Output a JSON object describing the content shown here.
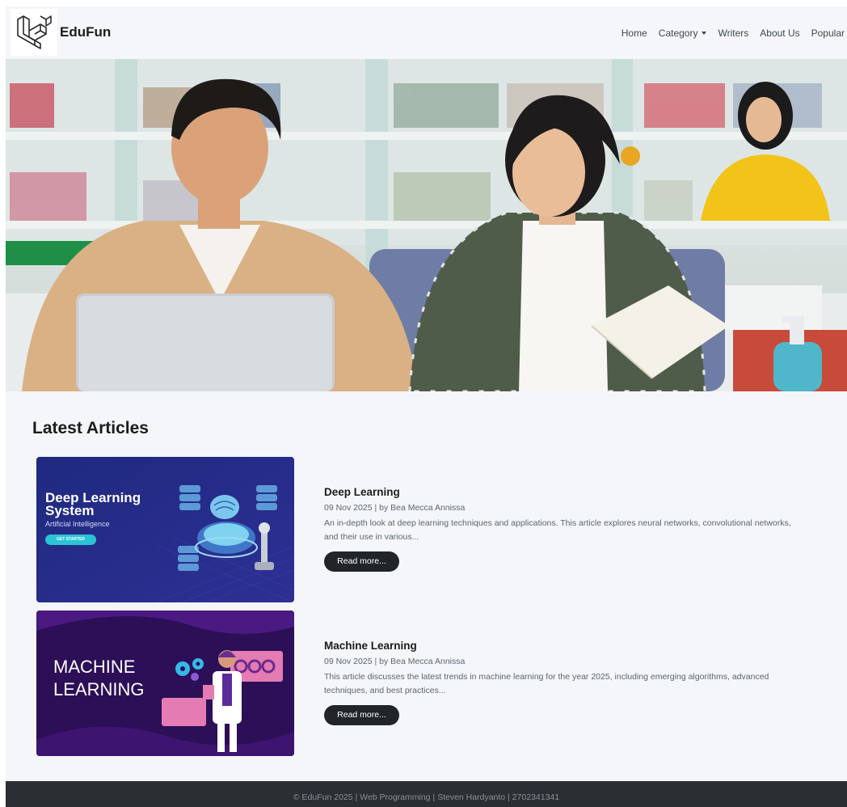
{
  "brand": {
    "name": "EduFun",
    "logo_icon": "laravel-logo-icon"
  },
  "nav": {
    "items": [
      {
        "label": "Home"
      },
      {
        "label": "Category",
        "has_dropdown": true
      },
      {
        "label": "Writers"
      },
      {
        "label": "About Us"
      },
      {
        "label": "Popular"
      }
    ]
  },
  "hero": {
    "image": "students-in-library-photo"
  },
  "articles_section": {
    "title": "Latest Articles",
    "articles": [
      {
        "thumb": {
          "heading_line1": "Deep Learning",
          "heading_line2": "System",
          "subtitle": "Artificial Intelligence",
          "cta": "GET STARTED"
        },
        "title": "Deep Learning",
        "meta": "09 Nov 2025 | by Bea Mecca Annissa",
        "description": "An in-depth look at deep learning techniques and applications. This article explores neural networks, convolutional networks, and their use in various...",
        "button": "Read more..."
      },
      {
        "thumb": {
          "heading_line1": "MACHINE",
          "heading_line2": "LEARNING"
        },
        "title": "Machine Learning",
        "meta": "09 Nov 2025 | by Bea Mecca Annissa",
        "description": "This article discusses the latest trends in machine learning for the year 2025, including emerging algorithms, advanced techniques, and best practices...",
        "button": "Read more..."
      }
    ]
  },
  "footer": {
    "text": "© EduFun 2025 | Web Programming | Steven Hardyanto | 2702341341"
  },
  "colors": {
    "background": "#f4f6f9",
    "button": "#212529",
    "footer": "#2b2f33",
    "thumb1": "#2a2f8c",
    "thumb2": "#33135f"
  }
}
